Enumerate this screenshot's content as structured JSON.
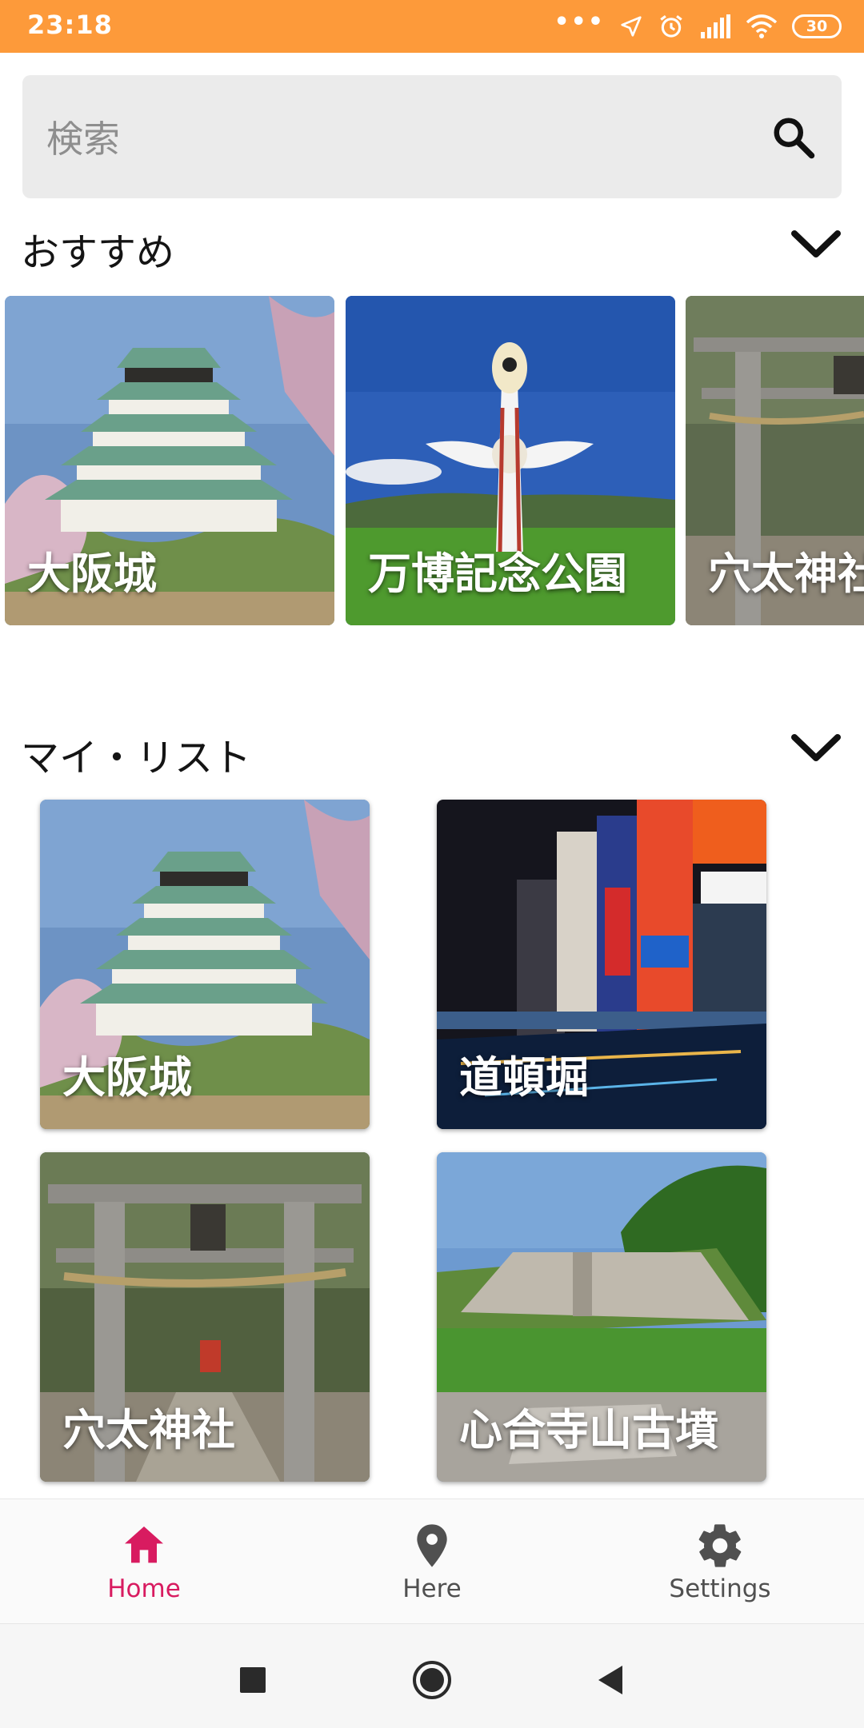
{
  "status_bar": {
    "time": "23:18",
    "battery": "30",
    "icons": [
      "more-dots-icon",
      "location-arrow-icon",
      "alarm-icon",
      "signal-icon",
      "wifi-icon",
      "battery-icon"
    ]
  },
  "search": {
    "placeholder": "検索",
    "icon": "search-icon"
  },
  "recommended": {
    "title": "おすすめ",
    "items": [
      {
        "label": "大阪城"
      },
      {
        "label": "万博記念公園"
      },
      {
        "label": "穴太神社"
      }
    ]
  },
  "my_list": {
    "title": "マイ・リスト",
    "items": [
      {
        "label": "大阪城"
      },
      {
        "label": "道頓堀"
      },
      {
        "label": "穴太神社"
      },
      {
        "label": "心合寺山古墳"
      }
    ]
  },
  "bottom_nav": {
    "items": [
      {
        "label": "Home",
        "icon": "home-icon",
        "active": true
      },
      {
        "label": "Here",
        "icon": "location-pin-icon",
        "active": false
      },
      {
        "label": "Settings",
        "icon": "gear-icon",
        "active": false
      }
    ]
  },
  "colors": {
    "status_bar": "#fd9a3a",
    "active": "#d81b60",
    "inactive": "#505050"
  }
}
